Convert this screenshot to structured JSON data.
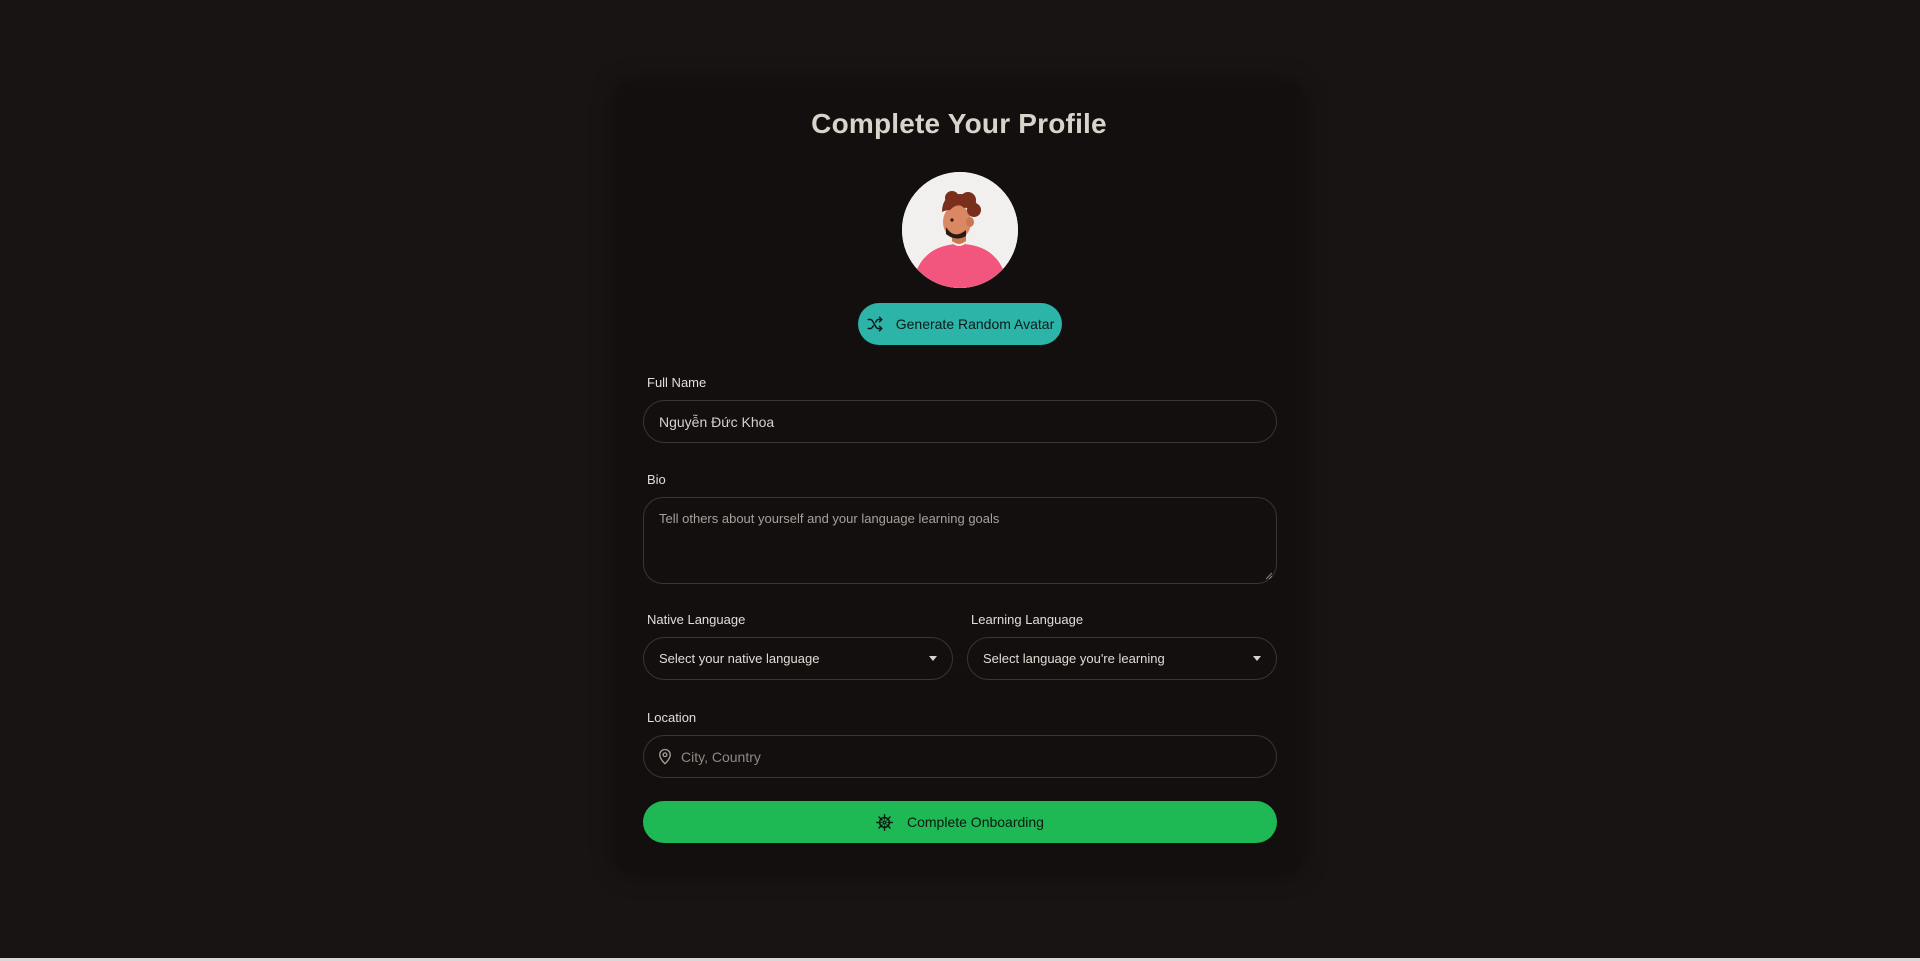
{
  "page": {
    "title": "Complete Your Profile"
  },
  "avatar": {
    "icon": "avatar-illustration",
    "generate_label": "Generate Random Avatar",
    "generate_icon": "shuffle-icon"
  },
  "form": {
    "full_name": {
      "label": "Full Name",
      "value": "Nguyễn Đức Khoa"
    },
    "bio": {
      "label": "Bio",
      "placeholder": "Tell others about yourself and your language learning goals"
    },
    "native_language": {
      "label": "Native Language",
      "selected": "Select your native language"
    },
    "learning_language": {
      "label": "Learning Language",
      "selected": "Select language you're learning"
    },
    "location": {
      "label": "Location",
      "placeholder": "City, Country",
      "icon": "map-pin-icon"
    }
  },
  "submit": {
    "label": "Complete Onboarding",
    "icon": "ship-wheel-icon"
  },
  "colors": {
    "background": "#171413",
    "card": "#120f0e",
    "accent_teal": "#2cb4a8",
    "accent_green": "#1eb955"
  }
}
